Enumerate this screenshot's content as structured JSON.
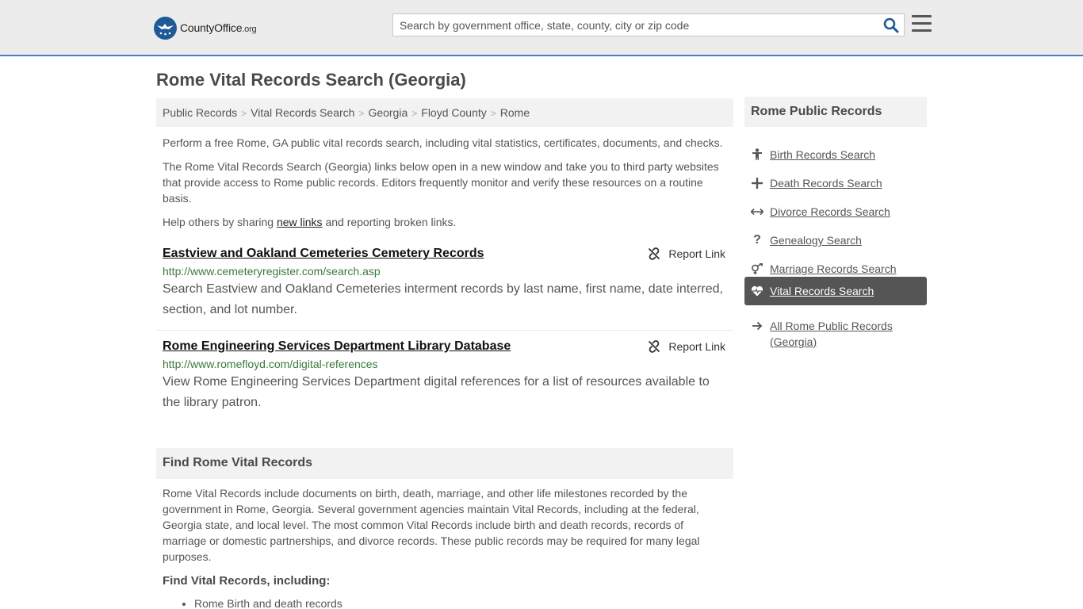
{
  "header": {
    "logo_name": "County",
    "logo_emph": "Office",
    "logo_tld": ".org",
    "search_placeholder": "Search by government office, state, county, city or zip code"
  },
  "page_title": "Rome Vital Records Search (Georgia)",
  "breadcrumb": [
    "Public Records",
    "Vital Records Search",
    "Georgia",
    "Floyd County",
    "Rome"
  ],
  "intro": {
    "p1": "Perform a free Rome, GA public vital records search, including vital statistics, certificates, documents, and checks.",
    "p2": "The Rome Vital Records Search (Georgia) links below open in a new window and take you to third party websites that provide access to Rome public records. Editors frequently monitor and verify these resources on a routine basis.",
    "p3_before": "Help others by sharing ",
    "p3_link": "new links",
    "p3_after": " and reporting broken links."
  },
  "records": [
    {
      "title": "Eastview and Oakland Cemeteries Cemetery Records",
      "url": "http://www.cemeteryregister.com/search.asp",
      "description": "Search Eastview and Oakland Cemeteries interment records by last name, first name, date interred, section, and lot number.",
      "report_label": "Report Link"
    },
    {
      "title": "Rome Engineering Services Department Library Database",
      "url": "http://www.romefloyd.com/digital-references",
      "description": "View Rome Engineering Services Department digital references for a list of resources available to the library patron.",
      "report_label": "Report Link"
    }
  ],
  "find_section": {
    "heading": "Find Rome Vital Records",
    "body": "Rome Vital Records include documents on birth, death, marriage, and other life milestones recorded by the government in Rome, Georgia. Several government agencies maintain Vital Records, including at the federal, Georgia state, and local level. The most common Vital Records include birth and death records, records of marriage or domestic partnerships, and divorce records. These public records may be required for many legal purposes.",
    "subheading": "Find Vital Records, including:",
    "bullets": [
      "Rome Birth and death records"
    ]
  },
  "sidebar": {
    "heading": "Rome Public Records",
    "items": [
      {
        "label": "Birth Records Search",
        "icon": "child-icon"
      },
      {
        "label": "Death Records Search",
        "icon": "cross-icon"
      },
      {
        "label": "Divorce Records Search",
        "icon": "arrows-icon"
      },
      {
        "label": "Genealogy Search",
        "icon": "question-icon"
      },
      {
        "label": "Marriage Records Search",
        "icon": "gender-icon"
      },
      {
        "label": "Vital Records Search",
        "icon": "heartbeat-icon",
        "active": true
      },
      {
        "label": "All Rome Public Records (Georgia)",
        "icon": "arrow-right-icon"
      }
    ]
  }
}
